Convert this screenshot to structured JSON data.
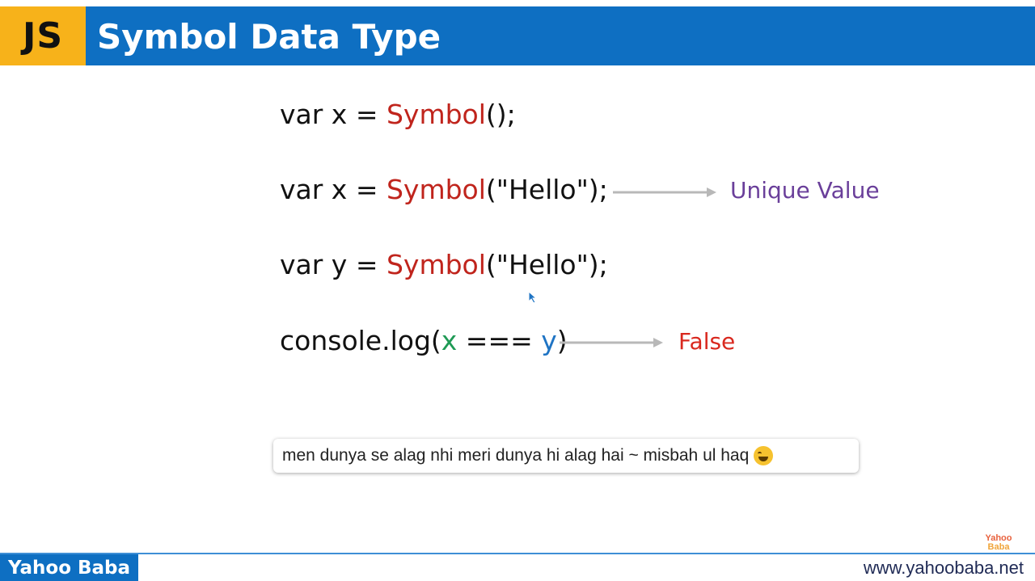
{
  "header": {
    "badge": "JS",
    "title": "Symbol Data Type"
  },
  "code": {
    "line1": {
      "prefix": "var x = ",
      "fn": "Symbol",
      "suffix": "();"
    },
    "line2": {
      "prefix": "var x = ",
      "fn": "Symbol",
      "suffix": "(\"Hello\");"
    },
    "line3": {
      "prefix": "var y = ",
      "fn": "Symbol",
      "suffix": "(\"Hello\");"
    },
    "line4": {
      "prefix": "console.log(",
      "x": "x",
      "op": " === ",
      "y": "y",
      "suffix": ")"
    }
  },
  "annotations": {
    "unique": "Unique Value",
    "result": "False"
  },
  "comment": {
    "text": "men dunya se alag nhi meri dunya hi alag hai ~ misbah ul haq",
    "emoji": "rolling-on-floor-laughing-icon"
  },
  "footer": {
    "brand": "Yahoo Baba",
    "url": "www.yahoobaba.net",
    "logo_line1": "Yahoo",
    "logo_line2": "Baba"
  },
  "colors": {
    "header_blue": "#0e6fc2",
    "badge_orange": "#f7b21a",
    "symbol_red": "#c0241c",
    "unique_purple": "#6a3f9a",
    "false_red": "#d9281e",
    "var_green": "#1f9a55",
    "var_blue": "#1f74c4"
  }
}
